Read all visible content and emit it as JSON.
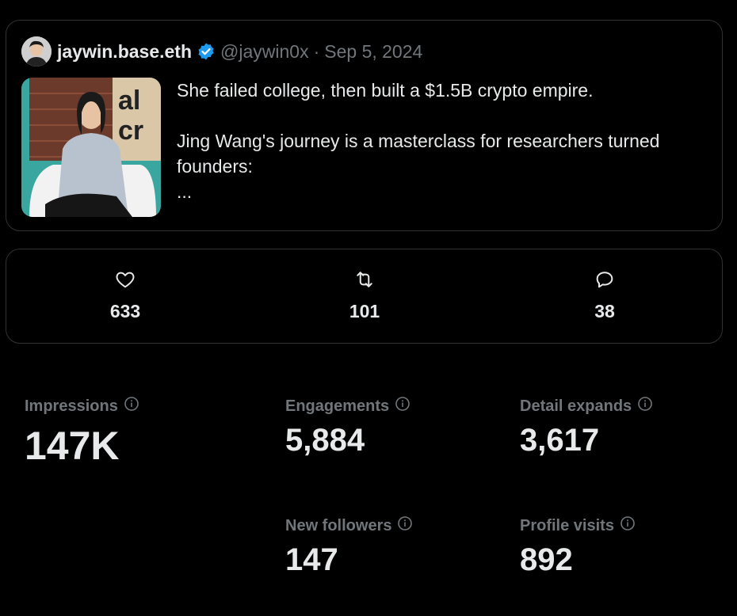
{
  "post": {
    "author_name": "jaywin.base.eth",
    "handle": "@jaywin0x",
    "separator": "·",
    "date": "Sep 5, 2024",
    "lines": [
      "She failed college, then built a $1.5B crypto empire.",
      "Jing Wang's journey is a masterclass for researchers turned founders:",
      "..."
    ]
  },
  "engagement": {
    "likes": "633",
    "reposts": "101",
    "replies": "38"
  },
  "metrics": {
    "impressions": {
      "label": "Impressions",
      "value": "147K"
    },
    "engagements": {
      "label": "Engagements",
      "value": "5,884"
    },
    "detail_expands": {
      "label": "Detail expands",
      "value": "3,617"
    },
    "new_followers": {
      "label": "New followers",
      "value": "147"
    },
    "profile_visits": {
      "label": "Profile visits",
      "value": "892"
    }
  },
  "colors": {
    "background": "#000000",
    "border": "#2f3336",
    "text": "#e7e9ea",
    "muted": "#71767b",
    "verified": "#1d9bf0"
  },
  "icons": [
    "heart-icon",
    "repost-icon",
    "reply-icon",
    "info-icon",
    "verified-badge-icon"
  ]
}
